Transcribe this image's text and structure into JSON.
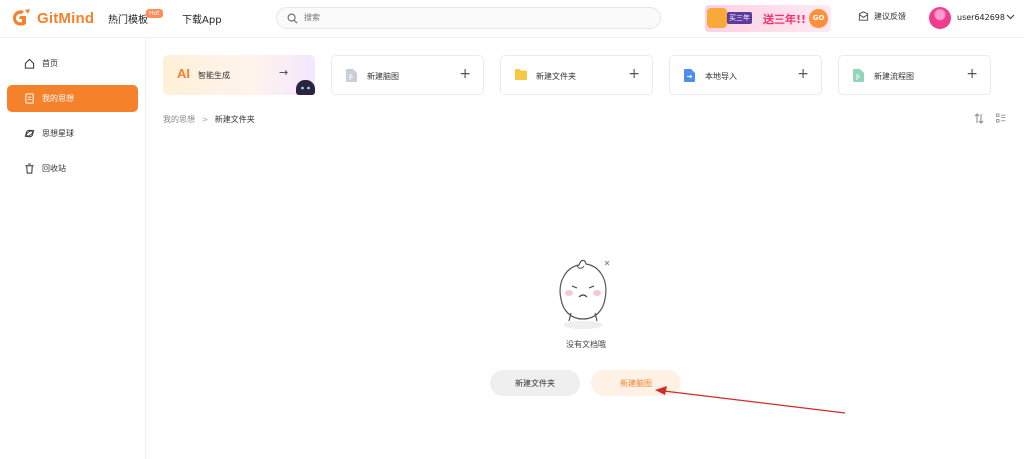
{
  "app": {
    "name": "GitMind",
    "brand_color": "#f5812b"
  },
  "header": {
    "nav": [
      {
        "label": "热门模板",
        "badge": "Hot"
      },
      {
        "label": "下载App"
      }
    ],
    "search": {
      "placeholder": "搜索",
      "value": ""
    },
    "promo": {
      "badge": "买三年",
      "text": "送三年!!",
      "go": "GO"
    },
    "feedback_label": "建议反馈",
    "user": {
      "name": "user642698"
    }
  },
  "sidebar": {
    "items": [
      {
        "label": "首页",
        "icon": "home-icon",
        "active": false
      },
      {
        "label": "我的思想",
        "icon": "document-icon",
        "active": true
      },
      {
        "label": "思想星球",
        "icon": "planet-icon",
        "active": false
      },
      {
        "label": "回收站",
        "icon": "trash-icon",
        "active": false
      }
    ]
  },
  "quick_actions": {
    "ai": {
      "mark": "AI",
      "label": "智能生成",
      "arrow": "→"
    },
    "cards": [
      {
        "label": "新建脑图",
        "icon": "mindmap-file-icon",
        "plus": "+"
      },
      {
        "label": "新建文件夹",
        "icon": "folder-icon",
        "plus": "+"
      },
      {
        "label": "本地导入",
        "icon": "import-icon",
        "plus": "+"
      },
      {
        "label": "新建流程图",
        "icon": "flowchart-file-icon",
        "plus": "+"
      }
    ]
  },
  "breadcrumb": {
    "root": "我的思想",
    "separator": ">",
    "current": "新建文件夹"
  },
  "empty_state": {
    "message": "没有文档哦",
    "buttons": {
      "new_folder": "新建文件夹",
      "new_mindmap": "新建脑图"
    }
  },
  "colors": {
    "annotation_arrow": "#d42a2a",
    "accent_soft": "#fff1e6"
  }
}
